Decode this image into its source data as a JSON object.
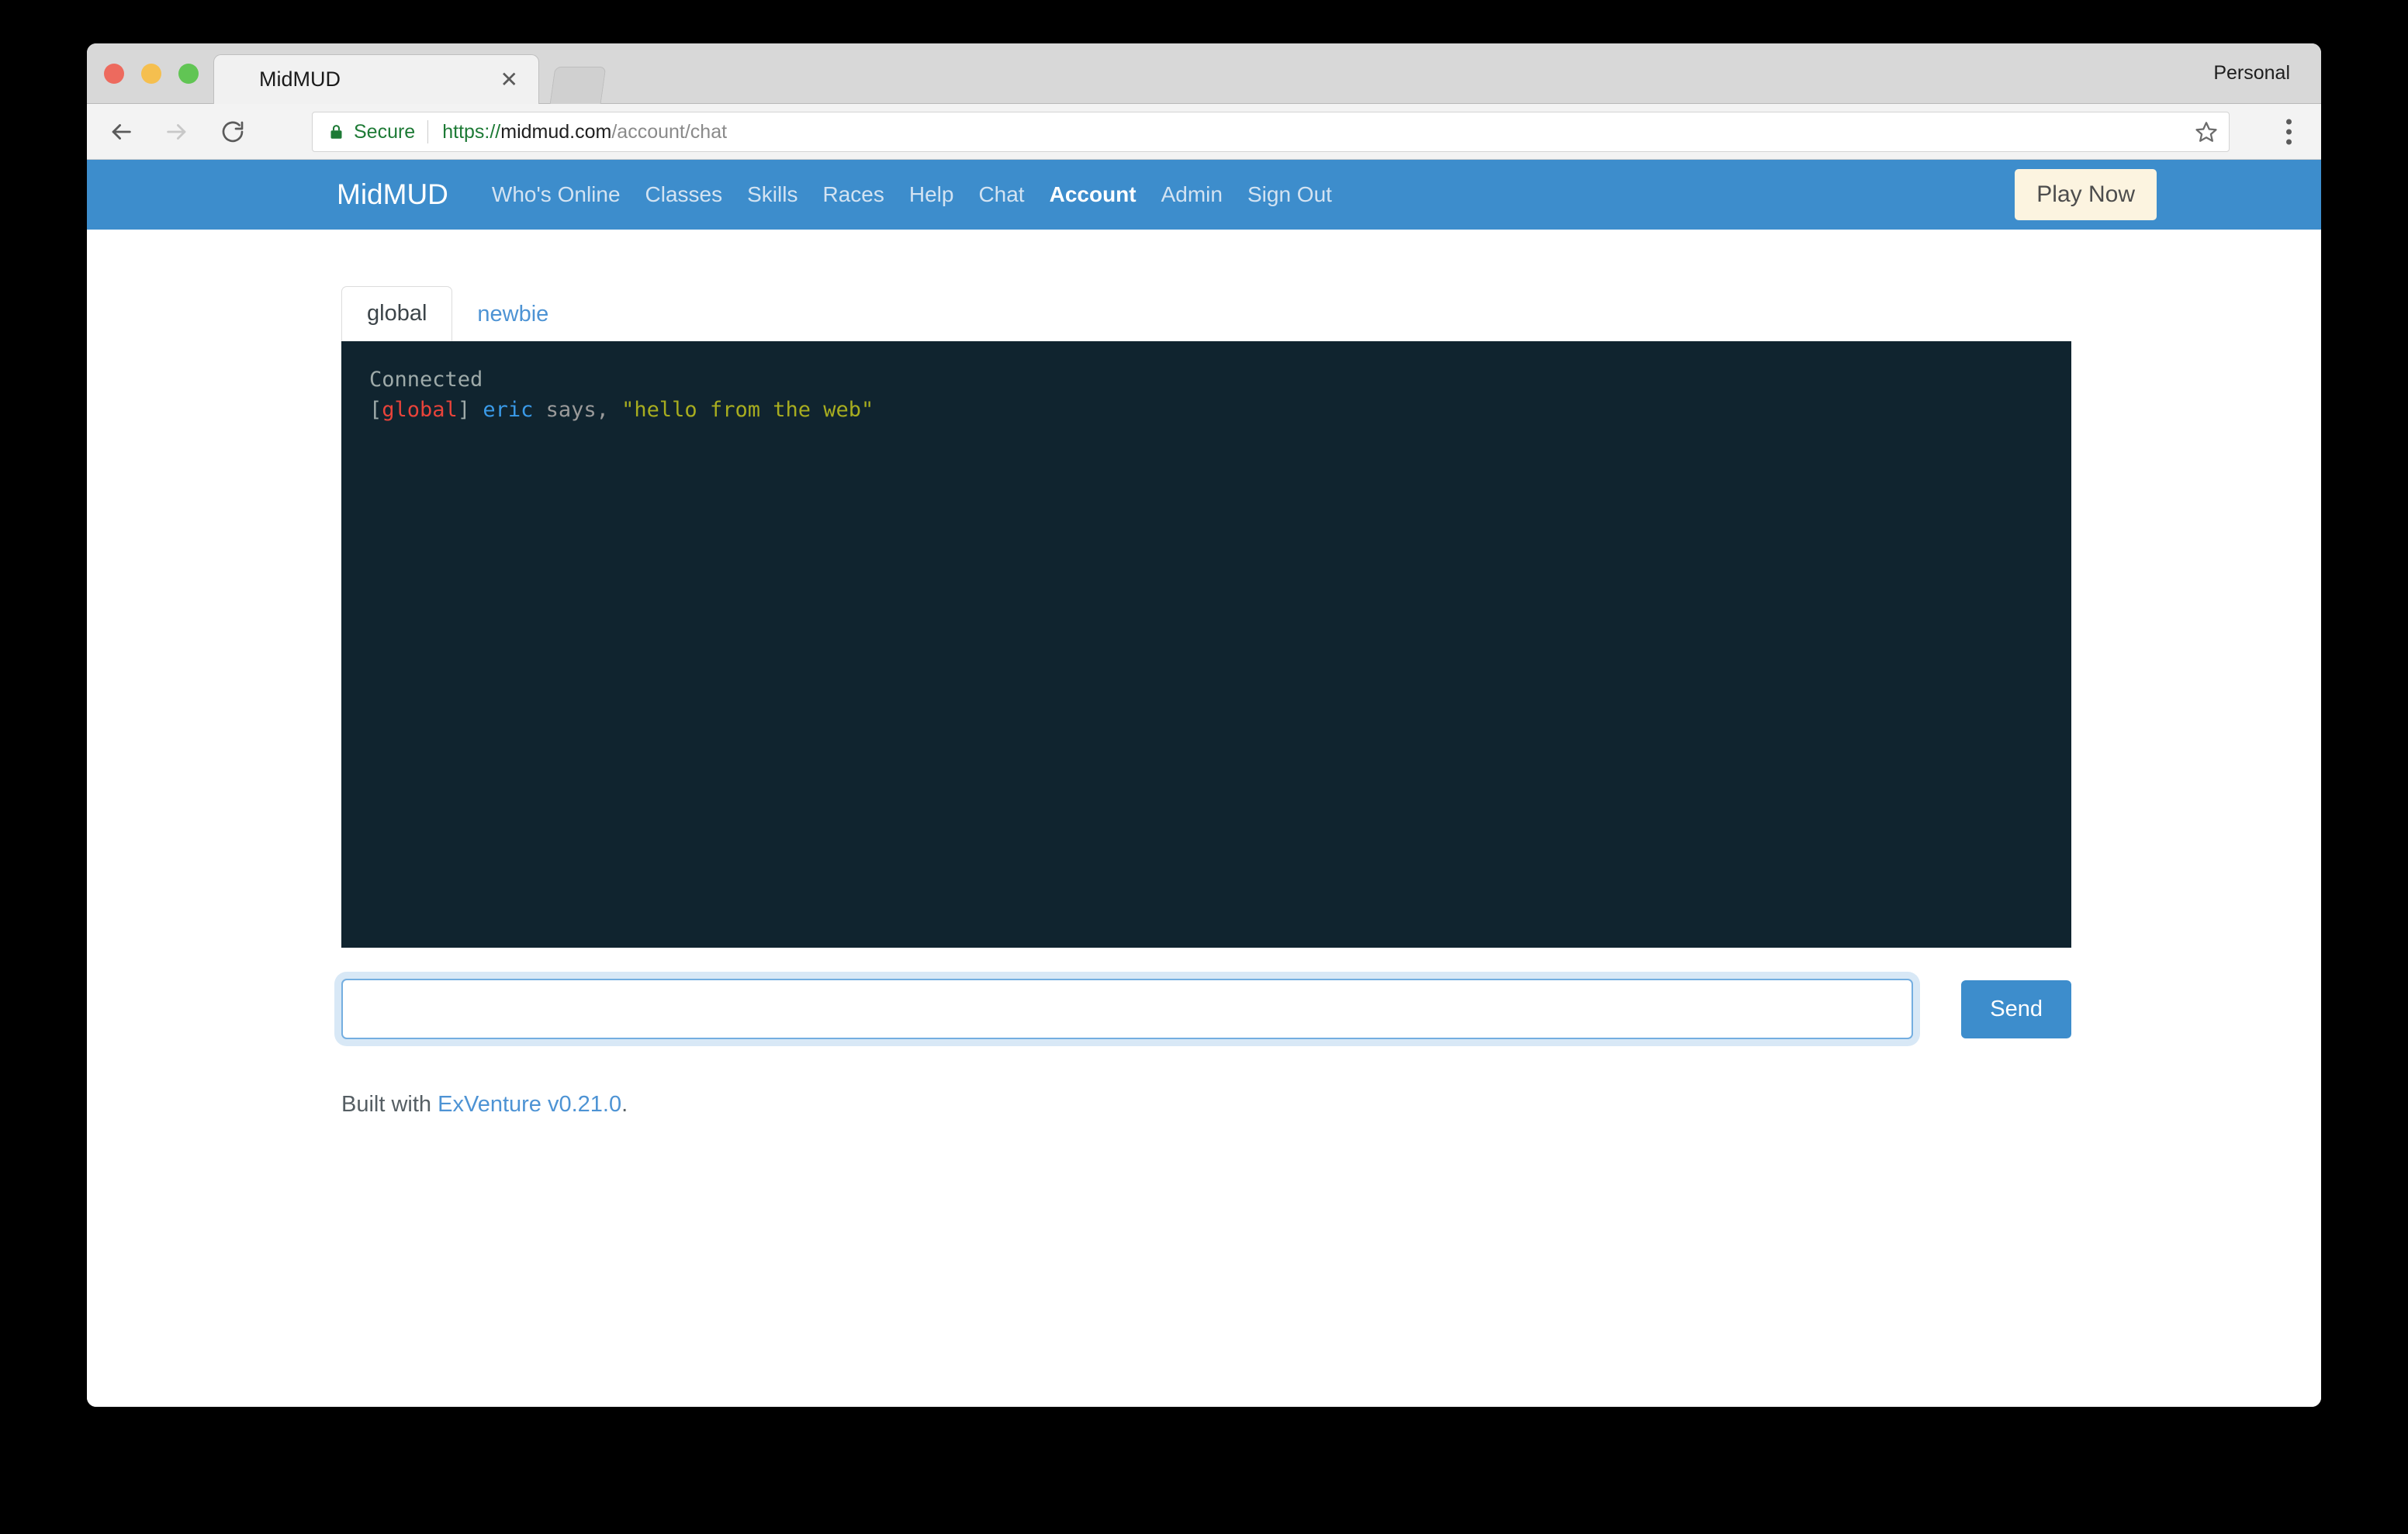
{
  "browser": {
    "tab_title": "MidMUD",
    "tab_close_icon": "close-icon",
    "profile_label": "Personal",
    "secure_label": "Secure",
    "url": {
      "scheme": "https://",
      "host": "midmud.com",
      "path": "/account/chat"
    },
    "back_icon": "back-arrow-icon",
    "forward_icon": "forward-arrow-icon",
    "reload_icon": "reload-icon",
    "lock_icon": "lock-icon",
    "bookmark_icon": "star-icon",
    "menu_icon": "kebab-menu-icon"
  },
  "navbar": {
    "brand": "MidMUD",
    "links": [
      {
        "label": "Who's Online",
        "active": false
      },
      {
        "label": "Classes",
        "active": false
      },
      {
        "label": "Skills",
        "active": false
      },
      {
        "label": "Races",
        "active": false
      },
      {
        "label": "Help",
        "active": false
      },
      {
        "label": "Chat",
        "active": false
      },
      {
        "label": "Account",
        "active": true
      },
      {
        "label": "Admin",
        "active": false
      },
      {
        "label": "Sign Out",
        "active": false
      }
    ],
    "play_now_label": "Play Now",
    "background_color": "#3d8dcc",
    "play_now_color": "#fcf4e0"
  },
  "chat": {
    "tabs": [
      {
        "label": "global",
        "active": true
      },
      {
        "label": "newbie",
        "active": false
      }
    ],
    "terminal_background": "#10242f",
    "lines": [
      {
        "segments": [
          {
            "text": "Connected",
            "class": "c-connected"
          }
        ]
      },
      {
        "segments": [
          {
            "text": "[",
            "class": "c-bracket"
          },
          {
            "text": "global",
            "class": "c-channel"
          },
          {
            "text": "] ",
            "class": "c-bracket"
          },
          {
            "text": "eric",
            "class": "c-name"
          },
          {
            "text": " says, ",
            "class": "c-says"
          },
          {
            "text": "\"hello from the web\"",
            "class": "c-message"
          }
        ]
      }
    ],
    "input_value": "",
    "input_placeholder": "",
    "send_label": "Send"
  },
  "footer": {
    "prefix": "Built with ",
    "link_label": "ExVenture v0.21.0",
    "suffix": "."
  }
}
